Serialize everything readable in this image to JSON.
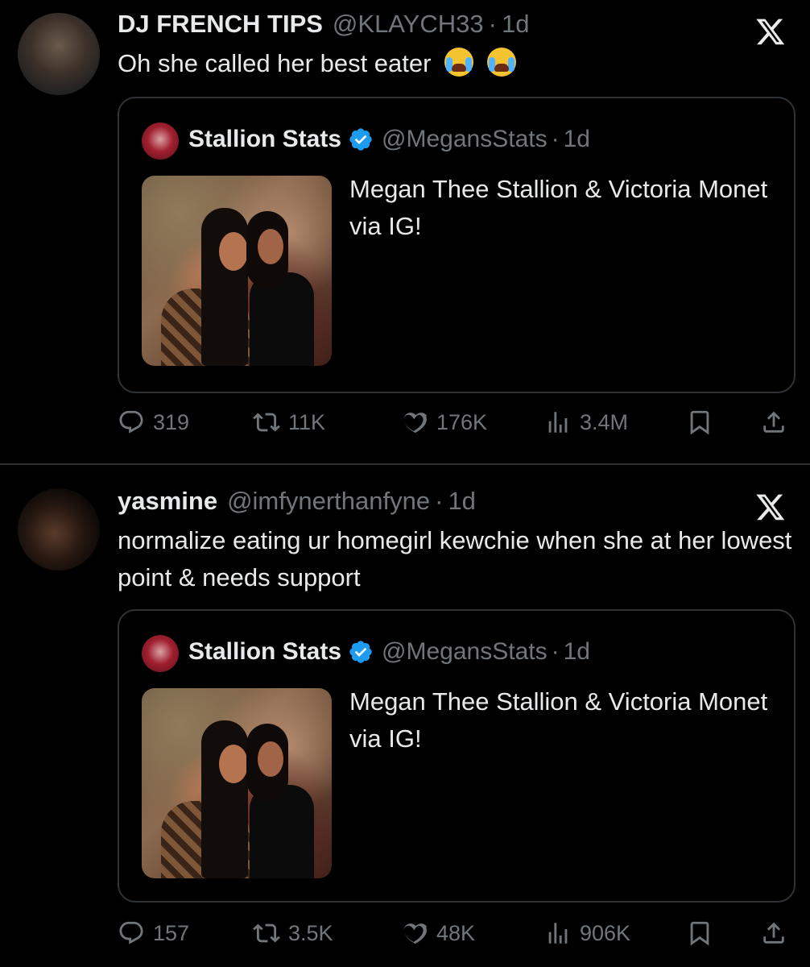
{
  "tweets": [
    {
      "display_name": "DJ FRENCH TIPS",
      "handle": "@KLAYCH33",
      "separator": "·",
      "time": "1d",
      "text": "Oh she called her best eater",
      "quote": {
        "display_name": "Stallion Stats",
        "handle": "@MegansStats",
        "separator": "·",
        "time": "1d",
        "text": "Megan Thee Stallion & Victoria Monet via IG!"
      },
      "stats": {
        "replies": "319",
        "retweets": "11K",
        "likes": "176K",
        "views": "3.4M"
      }
    },
    {
      "display_name": "yasmine",
      "handle": "@imfynerthanfyne",
      "separator": "·",
      "time": "1d",
      "text": "normalize eating ur homegirl kewchie when she at her lowest point & needs support",
      "quote": {
        "display_name": "Stallion Stats",
        "handle": "@MegansStats",
        "separator": "·",
        "time": "1d",
        "text": "Megan Thee Stallion & Victoria Monet via IG!"
      },
      "stats": {
        "replies": "157",
        "retweets": "3.5K",
        "likes": "48K",
        "views": "906K"
      }
    }
  ],
  "colors": {
    "background": "#000000",
    "text": "#e7e9ea",
    "muted": "#71767b",
    "border": "#2f3336",
    "verified": "#1d9bf0"
  },
  "icons": [
    "x-logo-icon",
    "verified-badge-icon",
    "reply-icon",
    "retweet-icon",
    "like-icon",
    "views-icon",
    "bookmark-icon",
    "share-icon",
    "loudly-crying-face-emoji"
  ]
}
